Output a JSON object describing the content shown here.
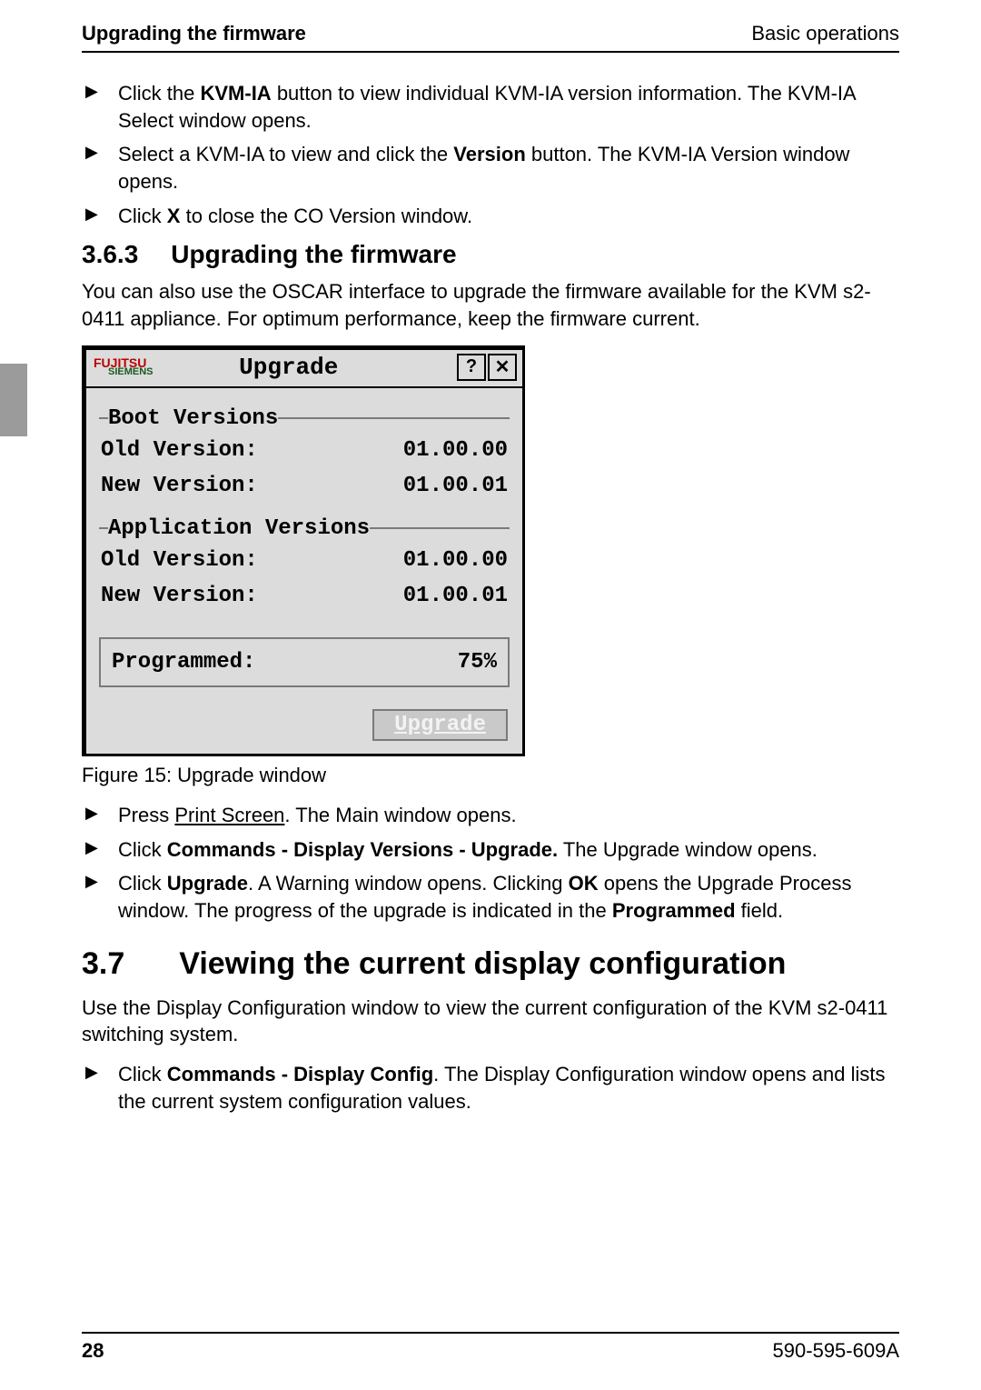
{
  "header": {
    "left": "Upgrading the firmware",
    "right": "Basic operations"
  },
  "bullets_top": [
    {
      "pre": "Click the ",
      "bold1": "KVM-IA",
      "post": " button to view individual KVM-IA version information. The KVM-IA Select window opens."
    },
    {
      "pre": "Select a KVM-IA to view and click the ",
      "bold1": "Version",
      "post": " button. The KVM-IA Version window opens."
    },
    {
      "pre": "Click ",
      "bold1": "X",
      "post": " to close the CO Version window."
    }
  ],
  "section_363": {
    "num": "3.6.3",
    "title": "Upgrading the firmware",
    "para": "You can also use the OSCAR interface to upgrade the firmware available for the KVM s2-0411 appliance. For optimum performance, keep the firmware current."
  },
  "upgrade_window": {
    "logo_top": "FUJITSU",
    "logo_sub": "SIEMENS",
    "title": "Upgrade",
    "help": "?",
    "close": "✕",
    "boot_label": "Boot Versions",
    "app_label": "Application Versions",
    "old_label": "Old Version:",
    "new_label": "New Version:",
    "boot_old": "01.00.00",
    "boot_new": "01.00.01",
    "app_old": "01.00.00",
    "app_new": "01.00.01",
    "programmed_label": "Programmed:",
    "programmed_val": "75%",
    "upgrade_btn": "Upgrade"
  },
  "caption": "Figure 15: Upgrade window",
  "bullets_after": [
    {
      "pre": "Press ",
      "ul": "Print Screen",
      "post": ". The Main window opens."
    },
    {
      "pre": "Click ",
      "bold1": "Commands - Display Versions - Upgrade.",
      "post": " The Upgrade window opens."
    },
    {
      "pre": "Click ",
      "bold1": "Upgrade",
      "mid": ". A Warning window opens. Clicking ",
      "bold2": "OK",
      "mid2": " opens the Upgrade Process window. The progress of the upgrade is indicated in the ",
      "bold3": "Programmed",
      "post": " field."
    }
  ],
  "section_37": {
    "num": "3.7",
    "title": "Viewing the current display configuration",
    "para": "Use the Display Configuration window to view the current configuration of the KVM s2-0411 switching system.",
    "bullet_pre": "Click ",
    "bullet_bold": "Commands - Display Config",
    "bullet_post": ". The Display Configuration window opens and lists the current system configuration values."
  },
  "footer": {
    "page": "28",
    "code": "590-595-609A"
  }
}
